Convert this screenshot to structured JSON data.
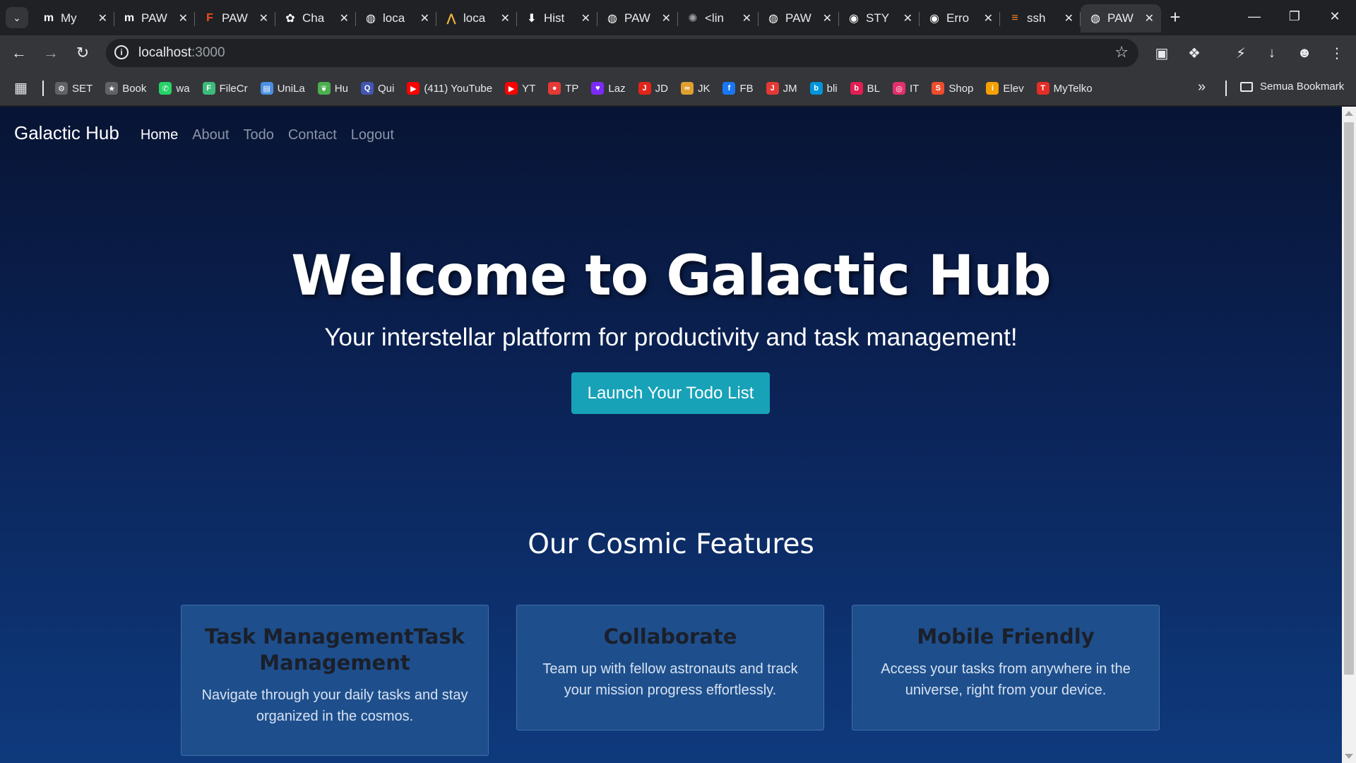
{
  "browser": {
    "tabs": [
      {
        "title": "My",
        "icon": "m-logo-icon",
        "color": "#ffffff"
      },
      {
        "title": "PAW",
        "icon": "m-logo-icon",
        "color": "#ffffff"
      },
      {
        "title": "PAW",
        "icon": "figma-icon",
        "color": "#f24e1e"
      },
      {
        "title": "Cha",
        "icon": "chatgpt-icon",
        "color": "#ffffff"
      },
      {
        "title": "loca",
        "icon": "globe-icon",
        "color": "#ffffff"
      },
      {
        "title": "loca",
        "icon": "vite-icon",
        "color": "#f0b43c"
      },
      {
        "title": "Hist",
        "icon": "download-icon",
        "color": "#ffffff"
      },
      {
        "title": "PAW",
        "icon": "globe-icon",
        "color": "#ffffff"
      },
      {
        "title": "<lin",
        "icon": "loading-icon",
        "color": "#9aa0a6"
      },
      {
        "title": "PAW",
        "icon": "globe-icon",
        "color": "#ffffff"
      },
      {
        "title": "STY",
        "icon": "github-icon",
        "color": "#ffffff"
      },
      {
        "title": "Erro",
        "icon": "github-icon",
        "color": "#ffffff"
      },
      {
        "title": "ssh",
        "icon": "stackoverflow-icon",
        "color": "#f48024"
      },
      {
        "title": "PAW",
        "icon": "globe-icon",
        "color": "#ffffff",
        "active": true
      }
    ],
    "url_host": "localhost",
    "url_port": ":3000",
    "bookmarks": [
      {
        "label": "SET",
        "icon": "gear-icon",
        "color": "#5f6368"
      },
      {
        "label": "Book",
        "icon": "star-icon",
        "color": "#5f6368"
      },
      {
        "label": "wa",
        "icon": "whatsapp-icon",
        "color": "#25d366"
      },
      {
        "label": "FileCr",
        "icon": "filecr-icon",
        "color": "#3dbb7a"
      },
      {
        "label": "UniLa",
        "icon": "document-icon",
        "color": "#4a90e2"
      },
      {
        "label": "Hu",
        "icon": "leaf-icon",
        "color": "#4caf50"
      },
      {
        "label": "Qui",
        "icon": "quizlet-icon",
        "color": "#4257b2"
      },
      {
        "label": "(411) YouTube",
        "icon": "youtube-icon",
        "color": "#ff0000"
      },
      {
        "label": "YT",
        "icon": "youtube-icon",
        "color": "#ff0000"
      },
      {
        "label": "TP",
        "icon": "tp-icon",
        "color": "#e53935"
      },
      {
        "label": "Laz",
        "icon": "lazada-icon",
        "color": "#7b2bf9"
      },
      {
        "label": "JD",
        "icon": "jd-icon",
        "color": "#e1251b"
      },
      {
        "label": "JK",
        "icon": "jk-icon",
        "color": "#e0a030"
      },
      {
        "label": "FB",
        "icon": "facebook-icon",
        "color": "#1877f2"
      },
      {
        "label": "JM",
        "icon": "jm-icon",
        "color": "#e53935"
      },
      {
        "label": "bli",
        "icon": "blibli-icon",
        "color": "#0095da"
      },
      {
        "label": "BL",
        "icon": "bukalapak-icon",
        "color": "#e31e52"
      },
      {
        "label": "IT",
        "icon": "instagram-icon",
        "color": "#e1306c"
      },
      {
        "label": "Shop",
        "icon": "shopee-icon",
        "color": "#ee4d2d"
      },
      {
        "label": "Elev",
        "icon": "elevenia-icon",
        "color": "#f4a100"
      },
      {
        "label": "MyTelko",
        "icon": "telkomsel-icon",
        "color": "#e52d27"
      }
    ],
    "all_bookmarks_label": "Semua Bookmark"
  },
  "site": {
    "brand": "Galactic Hub",
    "nav": [
      "Home",
      "About",
      "Todo",
      "Contact",
      "Logout"
    ],
    "hero_title": "Welcome to Galactic Hub",
    "hero_subtitle": "Your interstellar platform for productivity and task management!",
    "cta_label": "Launch Your Todo List",
    "features_title": "Our Cosmic Features",
    "features": [
      {
        "title": "Task ManagementTask Management",
        "text": "Navigate through your daily tasks and stay organized in the cosmos."
      },
      {
        "title": "Collaborate",
        "text": "Team up with fellow astronauts and track your mission progress effortlessly."
      },
      {
        "title": "Mobile Friendly",
        "text": "Access your tasks from anywhere in the universe, right from your device."
      }
    ]
  },
  "colors": {
    "accent": "#17a2b8",
    "page_bg_top": "#081434",
    "page_bg_bottom": "#0e3a7d",
    "card_bg": "#1e4f8c"
  }
}
